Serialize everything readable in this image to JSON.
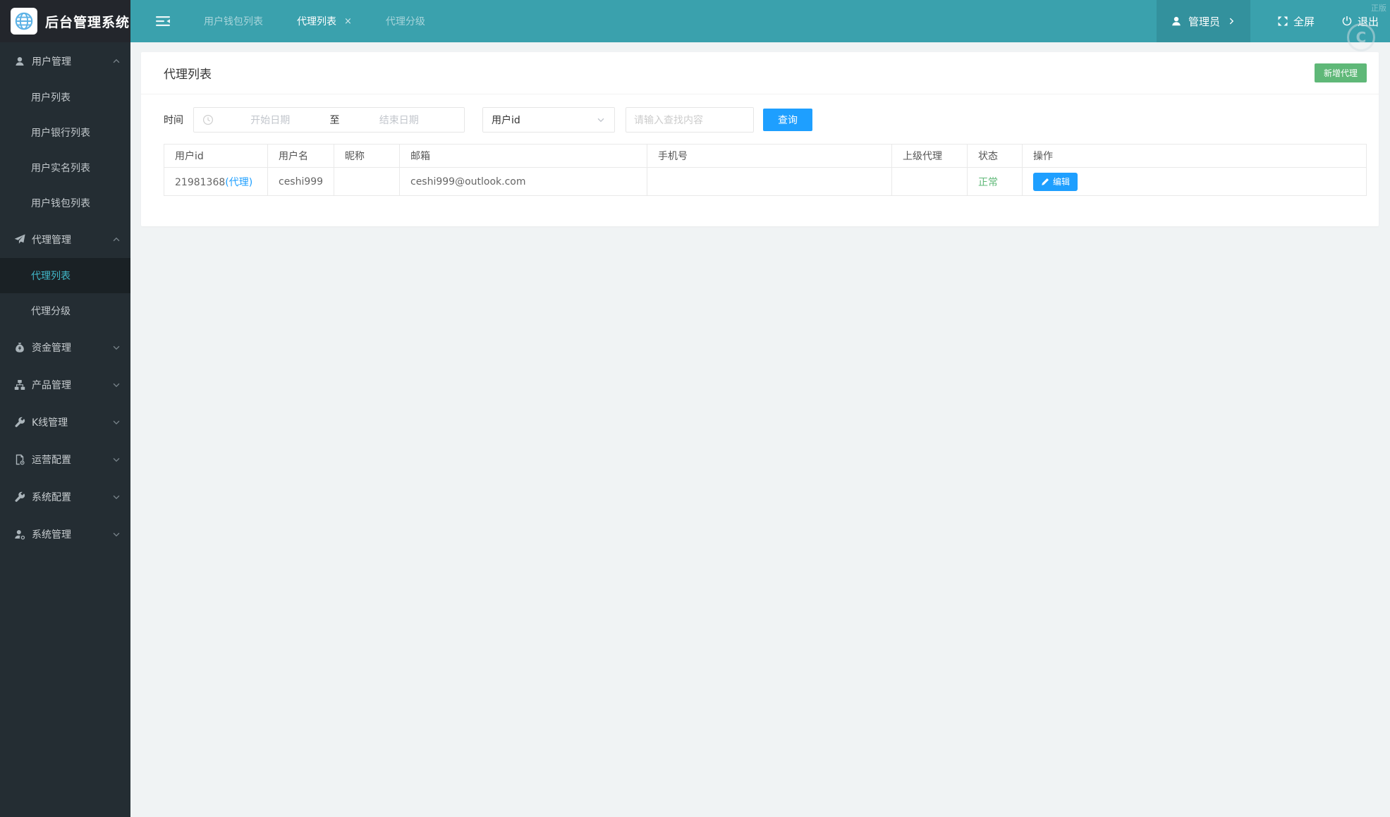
{
  "colors": {
    "header_teal": "#3aa1ad",
    "header_admin_block": "#33919d",
    "logo_bg": "#23262c",
    "sidebar_bg": "#242d33",
    "sidebar_active_text": "#41b8c9",
    "accent_blue": "#1e9fff",
    "accent_green": "#5fb878",
    "status_green": "#5fb878"
  },
  "header": {
    "logo_title": "后台管理系统",
    "tabs": [
      {
        "label": "用户钱包列表"
      },
      {
        "label": "代理列表",
        "close": "×"
      },
      {
        "label": "代理分级"
      }
    ],
    "admin_label": "管理员",
    "fullscreen_label": "全屏",
    "logout_label": "退出",
    "watermark_text": "正版",
    "watermark_mark": "C"
  },
  "sidebar": {
    "items": [
      {
        "label": "用户管理"
      },
      {
        "label": "用户列表"
      },
      {
        "label": "用户银行列表"
      },
      {
        "label": "用户实名列表"
      },
      {
        "label": "用户钱包列表"
      },
      {
        "label": "代理管理"
      },
      {
        "label": "代理列表"
      },
      {
        "label": "代理分级"
      },
      {
        "label": "资金管理"
      },
      {
        "label": "产品管理"
      },
      {
        "label": "K线管理"
      },
      {
        "label": "运营配置"
      },
      {
        "label": "系统配置"
      },
      {
        "label": "系统管理"
      }
    ]
  },
  "page": {
    "title": "代理列表",
    "add_button": "新增代理"
  },
  "filters": {
    "time_label": "时间",
    "start_placeholder": "开始日期",
    "range_separator": "至",
    "end_placeholder": "结束日期",
    "select_value": "用户id",
    "search_placeholder": "请输入查找内容",
    "search_value": "",
    "query_button": "查询"
  },
  "table": {
    "columns": [
      "用户id",
      "用户名",
      "昵称",
      "邮箱",
      "手机号",
      "上级代理",
      "状态",
      "操作"
    ],
    "row": {
      "user_id": "21981368",
      "user_id_tag": "(代理)",
      "username": "ceshi999",
      "nickname": "",
      "email": "ceshi999@outlook.com",
      "phone": "",
      "parent_agent": "",
      "status": "正常",
      "edit_label": "编辑"
    }
  }
}
